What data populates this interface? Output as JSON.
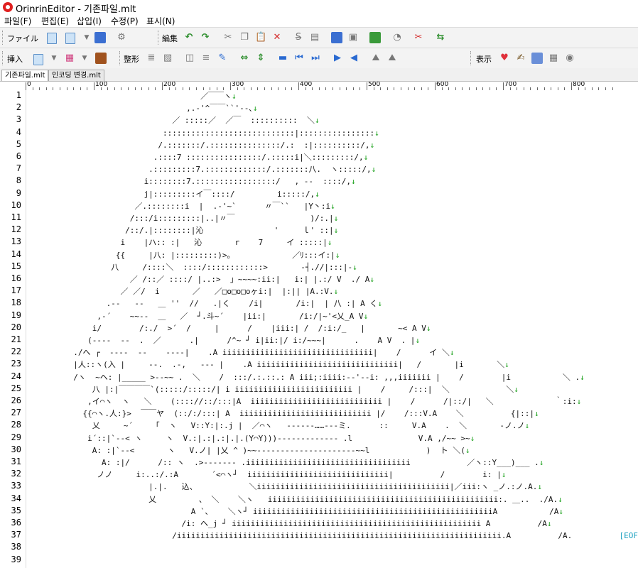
{
  "window": {
    "title": "OrinrinEditor - 기존파일.mlt"
  },
  "menu": [
    "파일(F)",
    "편집(E)",
    "삽입(I)",
    "수정(P)",
    "표시(N)"
  ],
  "toolbar1": {
    "label_file": "ファイル",
    "label_edit": "編集"
  },
  "toolbar2": {
    "label_insert": "挿入",
    "label_shape": "整形",
    "label_view": "表示"
  },
  "tabs": [
    "기존파일.mlt",
    "인코딩 변경.mlt"
  ],
  "ruler": [
    "0",
    "100",
    "200",
    "300",
    "400",
    "500",
    "600",
    "700",
    "800"
  ],
  "line_numbers": [
    "1",
    "2",
    "3",
    "4",
    "5",
    "6",
    "7",
    "8",
    "9",
    "10",
    "11",
    "12",
    "13",
    "14",
    "15",
    "16",
    "17",
    "18",
    "19",
    "20",
    "21",
    "22",
    "23",
    "24",
    "25",
    "26",
    "27",
    "28",
    "29",
    "30",
    "31",
    "32",
    "33",
    "34",
    "35",
    "36",
    "37",
    "38",
    "39"
  ],
  "newline_mark": "↓",
  "eof_mark": "[EOF]",
  "lines": [
    "                                     ／￣￣ヽ",
    "                                  ,.‐'^￣￣``'‐-､",
    "                               ／ :::::／  ／￣  ::::::::::  ＼",
    "                             ::::::::::::::::::::::::::::|::::::::::::::::",
    "                            /.:::::::/.:::::::::::::::/.:  :|::::::::::/,",
    "                           .::::7 ::::::::::::::::/.:::::i|＼:::::::::/,",
    "                          .:::::::::7.:::::::::::::/.:::::::八.  ヽ:::::/,",
    "                         i::::::::7.:::::::::::::::::/   , ‐-  ::::/,",
    "                         j|:::::::::イ￣::::/         i:::::/,",
    "                       ／.::::::::i  |  .-'~`      〃￣``   |Y丶:i",
    "                      /:::/i:::::::::|..|〃￣                )/:.|",
    "                     /::/.|::::::::|沁               '     ｌ' ::|",
    "                    i    |ハ:: :|   沁       r    7     イ :::::|",
    "                   {{     |八: |:::::::::)>｡             ／ﾘ:::イ:|",
    "                  八     /::::＼  ::::/::::::::::::>       ‐┤.//|:::|-",
    "                      ／ /::／ ::::/ |..:>  」~~~~:ii:|   i:| |.:/ V  ./ A",
    "                    ／ ／/  i       ／   ／□o□o□oヶi:|  |:|| |A.:V.",
    "                 .-‐   ‐‐   ＿ ''  //   .|く    /i|       /i:|  | 八 :| A く",
    "               ,-´    ~~‐-  ＿   ／  ┘.斗~´    |ii:|       /i:/|~'<乂_A V",
    "              i/        /:./  >´  /     |      /    |iii:| /  /:i:/_   |       ~< A V",
    "             (‐-‐-  ‐-  .  ／      .|      /^~ ┘ i|ii:|/ i:/~~~|      .    A V  . |",
    "          ./へ ┌  ‐-‐-  ‐-    ‐-‐-|    .A iiiiiiiiiiiiiiiiiiiiiiiiiiiiiiii|    /      イ ＼",
    "          |人::ヽ(入 |     ‐-.  .-,   ‐-‐ |    .A iiiiiiiiiiiiiiiiiiiiiiiiiiiiii|   /       |i       ＼",
    "          /ヽ  ~ヘ: |_____ >‐-~~ .  ＼    /  :::/.:.::.: A iii;:iiii:‐‐'‐‐i: ,,,iiiiiii |    /        |i           ＼ .",
    "              八 |:|￣￣￣￣`(:::::/:::::/| i iiiiiiiiiiiiiiiiiiiiiiiii |    /     /:::|  ＼            ＼",
    "             ,イ⌒ヽ  ヽ   ＼    (:::://::/:::|A  iiiiiiiiiiiiiiiiiiiiiiiiiiii |    /      /|::/|   ＼             ｀:i:",
    "            {{⌒ヽ.人:}>  ￣￣ヤ  (::/:/:::| A  iiiiiiiiiiiiiiiiiiiiiiiiiiii |/    /:::V.A    ＼          {|::|",
    "              乂     ~´    「  ヽ   V::Y:|:.j |  ／⌒ヽ   ‐-‐-‐-……‐‐‐ミ.      ::     V.A    .  ＼       ‐ノ.ノ",
    "             i´::|`‐-< ヽ     ヽ  V.:|.:|.:|.|.(Y⌒Y)))‐‐‐‐‐‐‐‐‐‐‐‐‐ .l              V.A ,/~~ >~",
    "              A: :|`‐-<       ヽ   V.ノ| |乂 ^ )~~‐‐‐‐‐‐‐‐‐‐‐‐‐‐‐‐‐‐‐‐‐~~l            )  ト ＼(",
    "                A: :|/      /:: ヽ  .>‐-‐-‐-‐ .iiiiiiiiiiiiiiiiiiiiiiiiiiiiiiiiiii            ／ヽ::Y___)___ .",
    "               ノノ     i:..:/.:A       ´<⌒ヽ┘  iiiiiiiiiiiiiiiiiiiiiiiiiiiiii|          /        i: |",
    "                          |.|.   込、           ＼iiiiiiiiiiiiiiiiiiiiiiiiiiiiiiiiiiiiiiiii|／iii:ヽ _ノ.:ノ.A.",
    "                          乂         、 ＼    ＼ヽ   iiiiiiiiiiiiiiiiiiiiiiiiiiiiiiiiiiiiiiiiiiiiiiiii:. ＿..  ./A.",
    "                                   A `､    ＼ヽ┘ iiiiiiiiiiiiiiiiiiiiiiiiiiiiiiiiiiiiiiiiiiiiiiiiiiiA           /A",
    "                                 /i: ヘ_j ┘ iiiiiiiiiiiiiiiiiiiiiiiiiiiiiiiiiiiiiiiiiiiiiiiiiiiii A          /A",
    "                               /iiiiiiiiiiiiiiiiiiiiiiiiiiiiiiiiiiiiiiiiiiiiiiiiiiiiiiiiiiiiiiiiiiiii.A          /A.",
    "",
    ""
  ]
}
